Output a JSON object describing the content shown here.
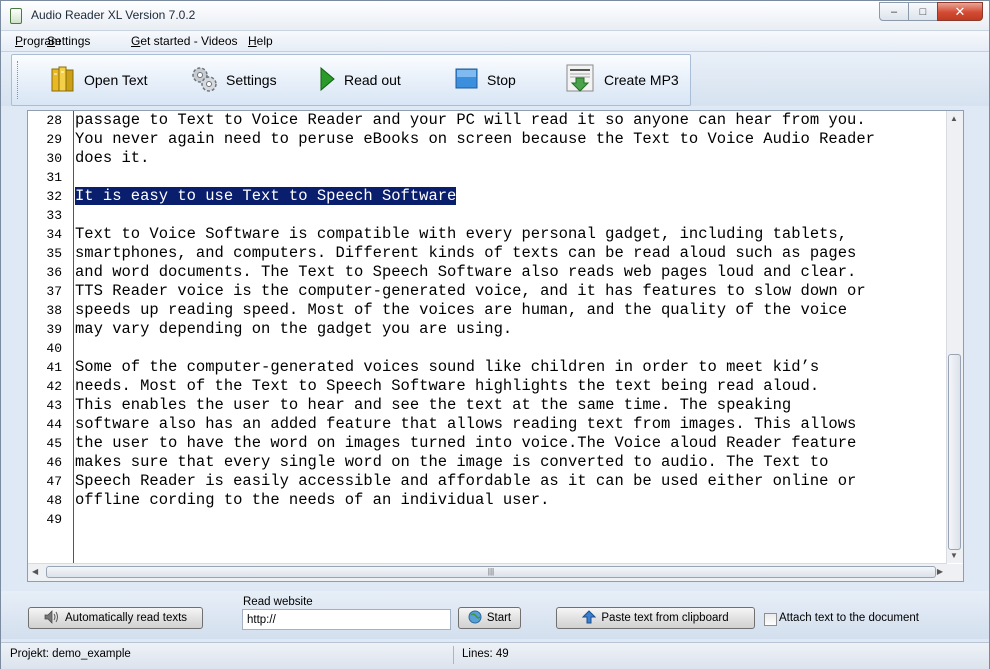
{
  "window": {
    "title": "Audio Reader XL Version 7.0.2",
    "controls": {
      "minimize": "–",
      "maximize": "□",
      "close": "✕"
    }
  },
  "menu": {
    "items": [
      {
        "label": "Program",
        "underline": "P",
        "rest": "rogram"
      },
      {
        "label": "Settings",
        "underline": "S",
        "rest": "ettings"
      },
      {
        "label": "Get started - Videos",
        "underline": "G",
        "rest": "et started - Videos"
      },
      {
        "label": "Help",
        "underline": "H",
        "rest": "elp"
      }
    ]
  },
  "toolbar": {
    "open_text": "Open Text",
    "settings": "Settings",
    "read_out": "Read out",
    "stop": "Stop",
    "create_mp3": "Create MP3"
  },
  "editor": {
    "line_numbers": [
      "28",
      "29",
      "30",
      "31",
      "32",
      "33",
      "34",
      "35",
      "36",
      "37",
      "38",
      "39",
      "40",
      "41",
      "42",
      "43",
      "44",
      "45",
      "46",
      "47",
      "48",
      "49"
    ],
    "lines": [
      "passage to Text to Voice Reader and your PC will read it so anyone can hear from you.",
      "You never again need to peruse eBooks on screen because the Text to Voice Audio Reader",
      "does it.",
      "",
      "It is easy to use Text to Speech Software",
      "",
      "Text to Voice Software is compatible with every personal gadget, including tablets,",
      "smartphones, and computers. Different kinds of texts can be read aloud such as pages",
      "and word documents. The Text to Speech Software also reads web pages loud and clear.",
      "TTS Reader voice is the computer-generated voice, and it has features to slow down or",
      "speeds up reading speed. Most of the voices are human, and the quality of the voice",
      "may vary depending on the gadget you are using.",
      "",
      "Some of the computer-generated voices sound like children in order to meet kid’s",
      "needs. Most of the Text to Speech Software highlights the text being read aloud.",
      "This enables the user to hear and see the text at the same time. The speaking",
      "software also has an added feature that allows reading text from images. This allows",
      "the user to have the word on images turned into voice.The Voice aloud Reader feature",
      "makes sure that every single word on the image is converted to audio. The Text to",
      "Speech Reader is easily accessible and affordable as it can be used either online or",
      "offline cording to the needs of an individual user.",
      ""
    ],
    "highlighted_line_index": 4
  },
  "bottom": {
    "auto_read_label": "Automatically read texts",
    "read_website_label": "Read website",
    "url_value": "http://",
    "start_label": "Start",
    "paste_label": "Paste text from clipboard",
    "attach_label": "Attach text to the document",
    "attach_checked": false
  },
  "status": {
    "project": "Projekt: demo_example",
    "lines": "Lines: 49"
  }
}
